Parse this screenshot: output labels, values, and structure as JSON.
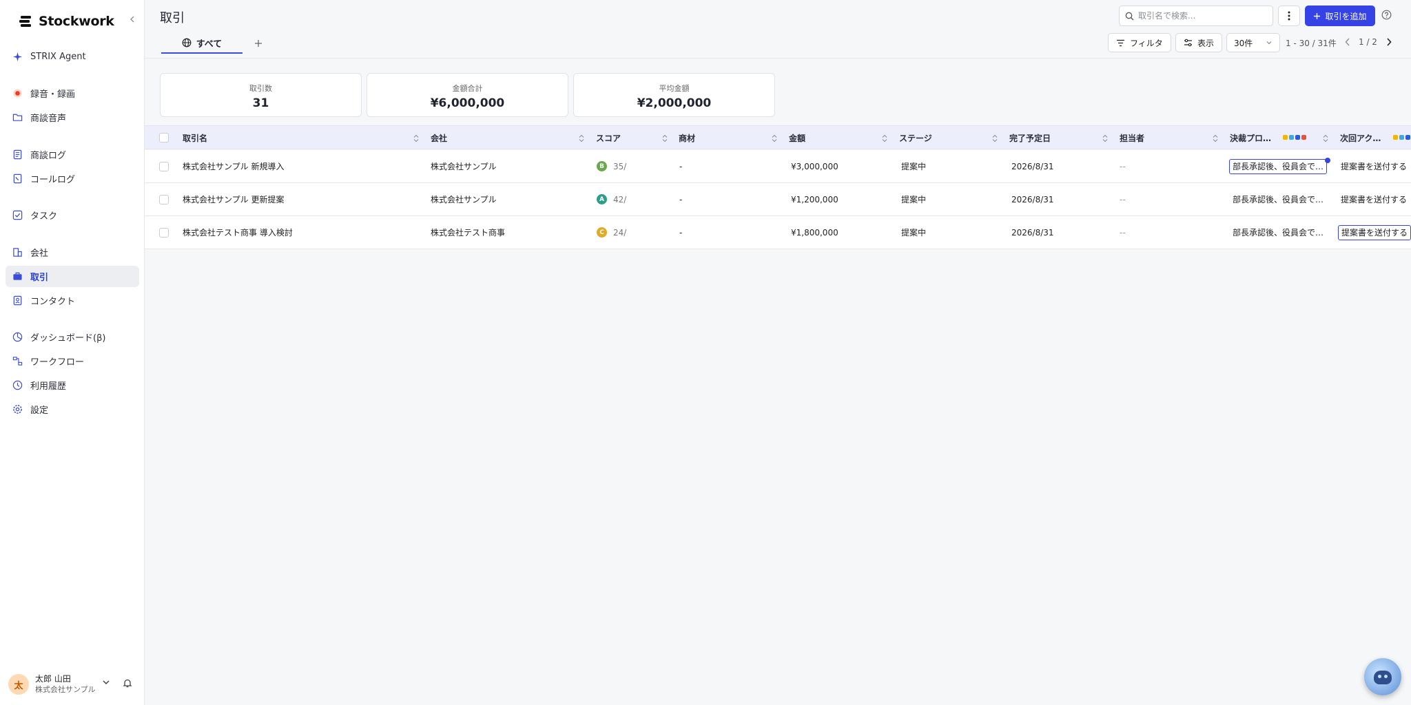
{
  "app": {
    "name": "Stockwork"
  },
  "sidebar": {
    "items": [
      {
        "label": "STRIX Agent",
        "icon": "sparkle-icon"
      },
      {
        "label": "録音・録画",
        "icon": "record-icon"
      },
      {
        "label": "商談音声",
        "icon": "folder-icon"
      },
      {
        "label": "商談ログ",
        "icon": "log-icon"
      },
      {
        "label": "コールログ",
        "icon": "phone-log-icon"
      },
      {
        "label": "タスク",
        "icon": "task-icon"
      },
      {
        "label": "会社",
        "icon": "building-icon"
      },
      {
        "label": "取引",
        "icon": "briefcase-icon",
        "active": true
      },
      {
        "label": "コンタクト",
        "icon": "contact-icon"
      },
      {
        "label": "ダッシュボード(β)",
        "icon": "dashboard-icon"
      },
      {
        "label": "ワークフロー",
        "icon": "workflow-icon"
      },
      {
        "label": "利用履歴",
        "icon": "history-icon"
      },
      {
        "label": "設定",
        "icon": "gear-icon"
      }
    ],
    "user": {
      "initial": "太",
      "name": "太郎 山田",
      "company": "株式会社サンプル"
    }
  },
  "header": {
    "title": "取引",
    "tab_all": "すべて",
    "search_placeholder": "取引名で検索...",
    "add_button": "取引を追加",
    "filter": "フィルタ",
    "display": "表示",
    "page_size": "30件",
    "range": "1 - 30 / 31件",
    "page": "1 / 2"
  },
  "stats": [
    {
      "label": "取引数",
      "value": "31"
    },
    {
      "label": "金額合計",
      "value": "¥6,000,000"
    },
    {
      "label": "平均金額",
      "value": "¥2,000,000"
    }
  ],
  "table": {
    "columns": [
      "取引名",
      "会社",
      "スコア",
      "商材",
      "金額",
      "ステージ",
      "完了予定日",
      "担当者",
      "決裁プロ…",
      "次回アク…"
    ],
    "rows": [
      {
        "name": "株式会社サンプル 新規導入",
        "company": "株式会社サンプル",
        "grade": "B",
        "grade_color": "#6aa84f",
        "score": "35/",
        "product": "-",
        "amount": "¥3,000,000",
        "stage": "提案中",
        "due": "2026/8/31",
        "owner": "--",
        "decision": "部長承認後、役員会で…",
        "next": "提案書を送付する"
      },
      {
        "name": "株式会社サンプル 更新提案",
        "company": "株式会社サンプル",
        "grade": "A",
        "grade_color": "#2e9e8a",
        "score": "42/",
        "product": "-",
        "amount": "¥1,200,000",
        "stage": "提案中",
        "due": "2026/8/31",
        "owner": "--",
        "decision": "部長承認後、役員会で…",
        "next": "提案書を送付する"
      },
      {
        "name": "株式会社テスト商事 導入検討",
        "company": "株式会社テスト商事",
        "grade": "C",
        "grade_color": "#e0a92a",
        "score": "24/",
        "product": "-",
        "amount": "¥1,800,000",
        "stage": "提案中",
        "due": "2026/8/31",
        "owner": "--",
        "decision": "部長承認後、役員会で…",
        "next": "提案書を送付する"
      }
    ]
  },
  "colors": {
    "accent": "#3442e6",
    "active_nav": "#2740d6"
  }
}
